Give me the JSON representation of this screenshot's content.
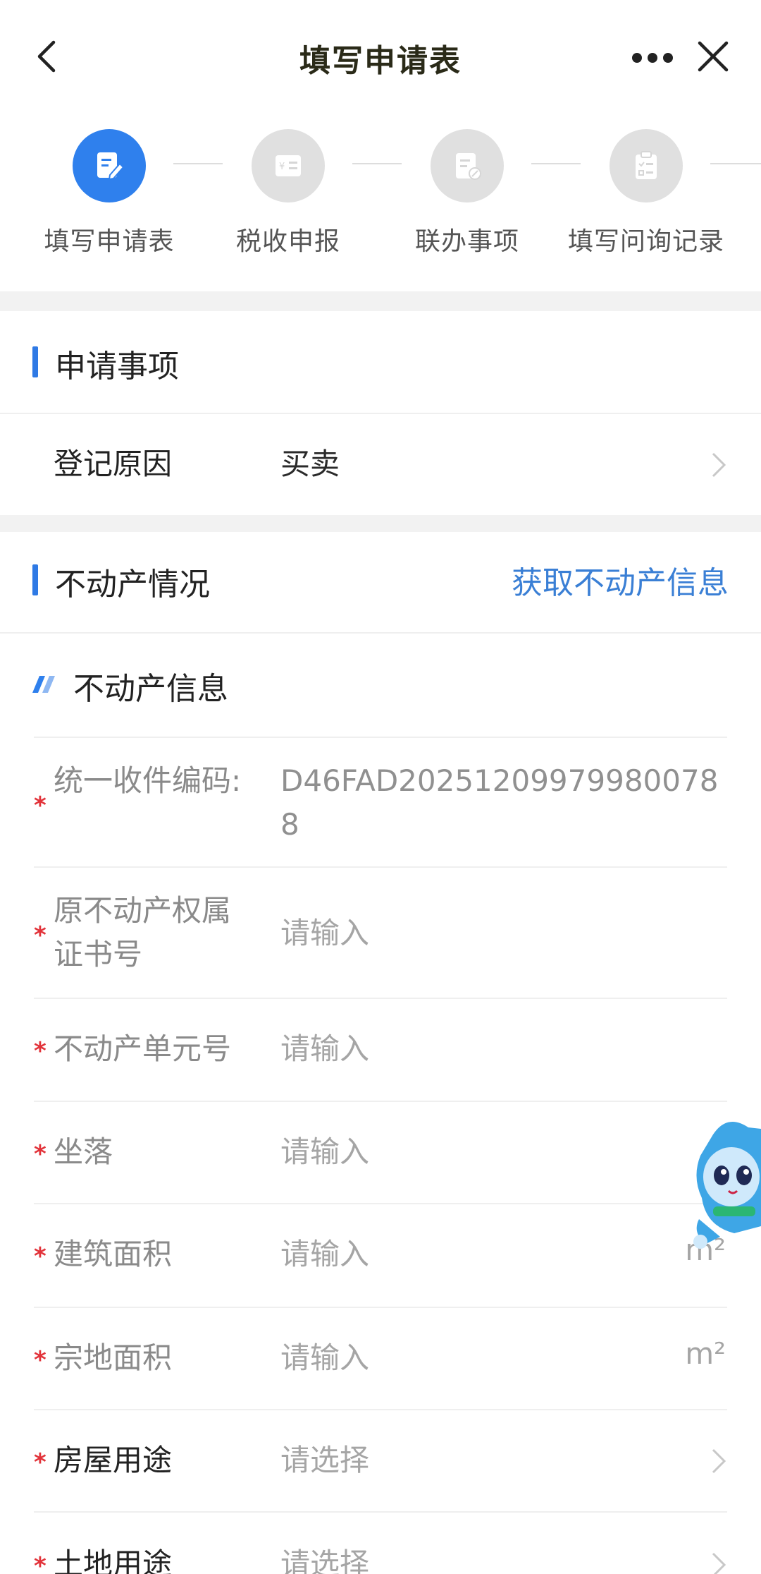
{
  "header": {
    "title": "填写申请表",
    "back_icon": "chevron-left-icon",
    "more_icon": "more-dots-icon",
    "close_icon": "close-icon"
  },
  "steps": [
    {
      "label": "填写申请表",
      "icon": "edit-form-icon",
      "active": true
    },
    {
      "label": "税收申报",
      "icon": "tax-icon",
      "active": false
    },
    {
      "label": "联办事项",
      "icon": "document-link-icon",
      "active": false
    },
    {
      "label": "填写问询记录",
      "icon": "checklist-icon",
      "active": false
    }
  ],
  "apply_section": {
    "title": "申请事项",
    "reason_label": "登记原因",
    "reason_value": "买卖"
  },
  "property_section": {
    "title": "不动产情况",
    "fetch_link": "获取不动产信息",
    "subtitle": "不动产信息"
  },
  "fields": {
    "code": {
      "label": "统一收件编码:",
      "value": "D46FAD2025120997998007​88"
    },
    "cert": {
      "label": "原不动产权属证书号",
      "placeholder": "请输入"
    },
    "unit_no": {
      "label": "不动产单元号",
      "placeholder": "请输入"
    },
    "location": {
      "label": "坐落",
      "placeholder": "请输入"
    },
    "building_area": {
      "label": "建筑面积",
      "placeholder": "请输入",
      "unit": "m²"
    },
    "land_area": {
      "label": "宗地面积",
      "placeholder": "请输入",
      "unit": "m²"
    },
    "house_use": {
      "label": "房屋用途",
      "placeholder": "请选择"
    },
    "land_use": {
      "label": "土地用途",
      "placeholder": "请选择"
    }
  },
  "required_mark": "*",
  "colors": {
    "accent": "#2f80ed",
    "link": "#3a7fd5",
    "required": "#e2333a"
  }
}
